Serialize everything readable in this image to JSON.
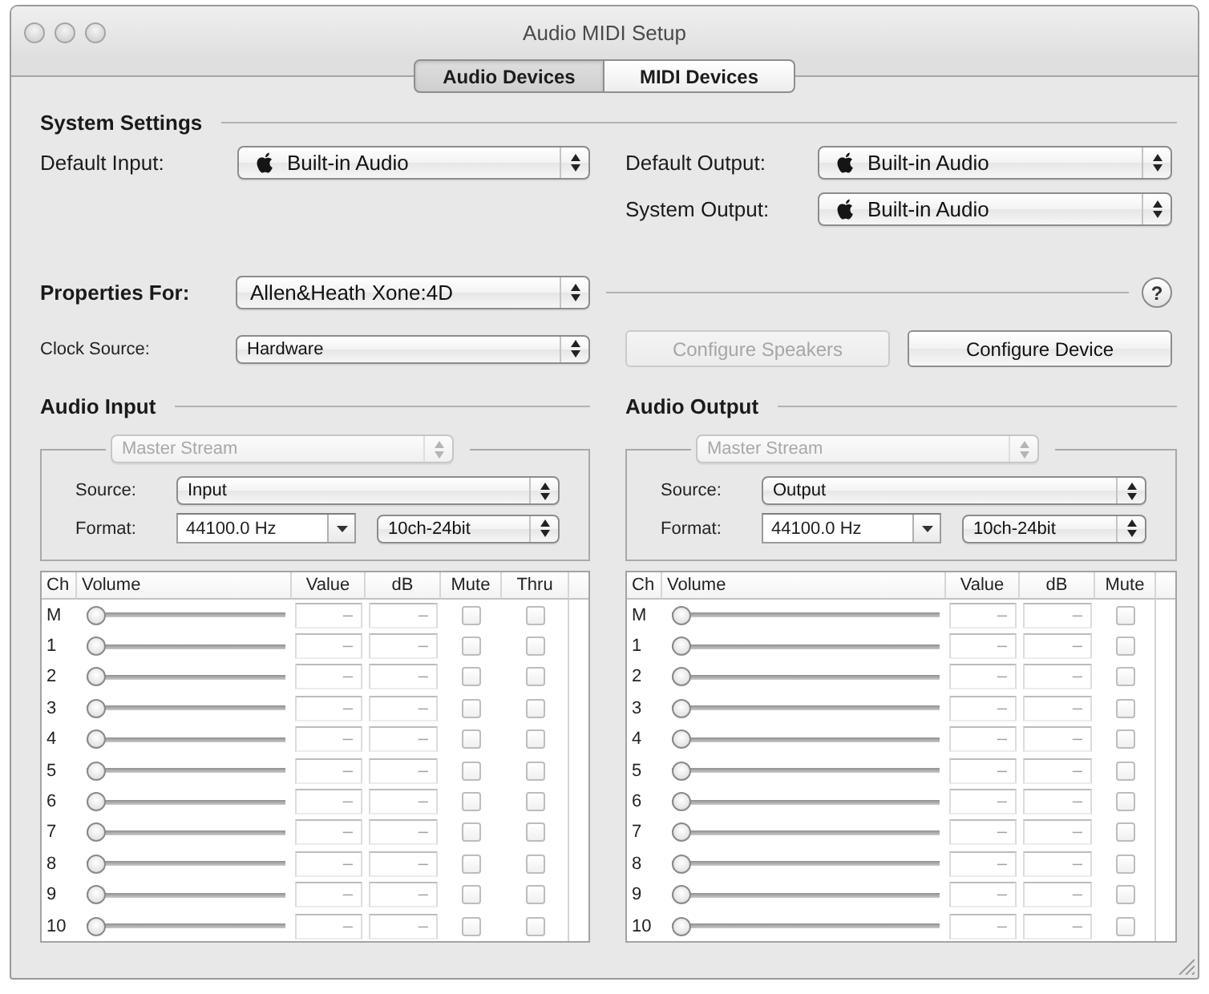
{
  "window": {
    "title": "Audio MIDI Setup"
  },
  "tabs": [
    {
      "label": "Audio Devices",
      "selected": true
    },
    {
      "label": "MIDI Devices",
      "selected": false
    }
  ],
  "system_settings": {
    "heading": "System Settings",
    "default_input": {
      "label": "Default Input:",
      "value": "Built-in Audio"
    },
    "default_output": {
      "label": "Default Output:",
      "value": "Built-in Audio"
    },
    "system_output": {
      "label": "System Output:",
      "value": "Built-in Audio"
    }
  },
  "properties": {
    "label": "Properties For:",
    "device": "Allen&Heath Xone:4D",
    "help": "?",
    "clock_source": {
      "label": "Clock Source:",
      "value": "Hardware"
    },
    "buttons": [
      {
        "label": "Configure Speakers",
        "disabled": true
      },
      {
        "label": "Configure Device",
        "disabled": false
      }
    ]
  },
  "panels": [
    {
      "heading": "Audio Input",
      "stream": {
        "value": "Master Stream",
        "disabled": true
      },
      "source": {
        "label": "Source:",
        "value": "Input"
      },
      "format": {
        "label": "Format:",
        "rate": "44100.0 Hz",
        "channels": "10ch-24bit"
      },
      "columns": [
        "Ch",
        "Volume",
        "Value",
        "dB",
        "Mute",
        "Thru"
      ],
      "rows": [
        {
          "ch": "M",
          "level": 0,
          "value": "–",
          "db": "–",
          "mute": false,
          "thru": false
        },
        {
          "ch": "1",
          "level": 0,
          "value": "–",
          "db": "–",
          "mute": false,
          "thru": false
        },
        {
          "ch": "2",
          "level": 0,
          "value": "–",
          "db": "–",
          "mute": false,
          "thru": false
        },
        {
          "ch": "3",
          "level": 0,
          "value": "–",
          "db": "–",
          "mute": false,
          "thru": false
        },
        {
          "ch": "4",
          "level": 0,
          "value": "–",
          "db": "–",
          "mute": false,
          "thru": false
        },
        {
          "ch": "5",
          "level": 0,
          "value": "–",
          "db": "–",
          "mute": false,
          "thru": false
        },
        {
          "ch": "6",
          "level": 0,
          "value": "–",
          "db": "–",
          "mute": false,
          "thru": false
        },
        {
          "ch": "7",
          "level": 0,
          "value": "–",
          "db": "–",
          "mute": false,
          "thru": false
        },
        {
          "ch": "8",
          "level": 0,
          "value": "–",
          "db": "–",
          "mute": false,
          "thru": false
        },
        {
          "ch": "9",
          "level": 0,
          "value": "–",
          "db": "–",
          "mute": false,
          "thru": false
        },
        {
          "ch": "10",
          "level": 0,
          "value": "–",
          "db": "–",
          "mute": false,
          "thru": false
        }
      ]
    },
    {
      "heading": "Audio Output",
      "stream": {
        "value": "Master Stream",
        "disabled": true
      },
      "source": {
        "label": "Source:",
        "value": "Output"
      },
      "format": {
        "label": "Format:",
        "rate": "44100.0 Hz",
        "channels": "10ch-24bit"
      },
      "columns": [
        "Ch",
        "Volume",
        "Value",
        "dB",
        "Mute"
      ],
      "rows": [
        {
          "ch": "M",
          "level": 0,
          "value": "–",
          "db": "–",
          "mute": false
        },
        {
          "ch": "1",
          "level": 0,
          "value": "–",
          "db": "–",
          "mute": false
        },
        {
          "ch": "2",
          "level": 0,
          "value": "–",
          "db": "–",
          "mute": false
        },
        {
          "ch": "3",
          "level": 0,
          "value": "–",
          "db": "–",
          "mute": false
        },
        {
          "ch": "4",
          "level": 0,
          "value": "–",
          "db": "–",
          "mute": false
        },
        {
          "ch": "5",
          "level": 0,
          "value": "–",
          "db": "–",
          "mute": false
        },
        {
          "ch": "6",
          "level": 0,
          "value": "–",
          "db": "–",
          "mute": false
        },
        {
          "ch": "7",
          "level": 0,
          "value": "–",
          "db": "–",
          "mute": false
        },
        {
          "ch": "8",
          "level": 0,
          "value": "–",
          "db": "–",
          "mute": false
        },
        {
          "ch": "9",
          "level": 0,
          "value": "–",
          "db": "–",
          "mute": false
        },
        {
          "ch": "10",
          "level": 0,
          "value": "–",
          "db": "–",
          "mute": false
        }
      ]
    }
  ]
}
